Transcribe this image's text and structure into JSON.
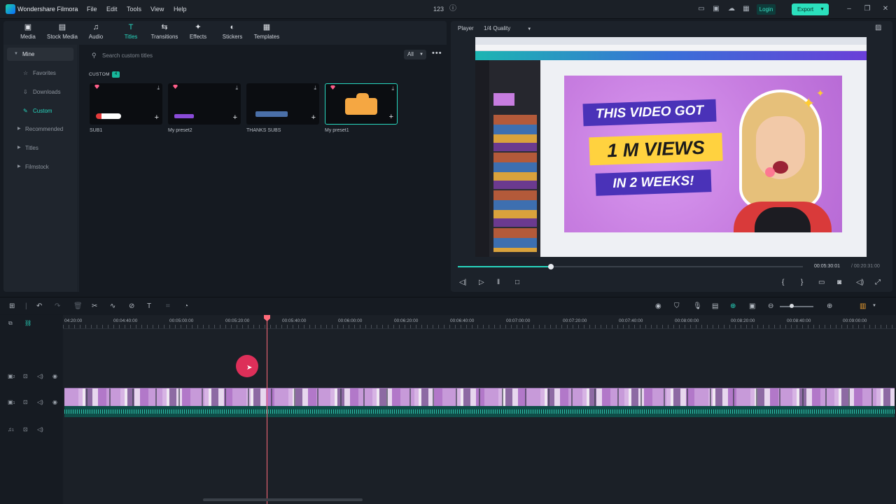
{
  "app": {
    "name": "Wondershare Filmora",
    "menu": [
      "File",
      "Edit",
      "Tools",
      "View",
      "Help"
    ],
    "project_counter": "123",
    "login_label": "Login",
    "export_label": "Export"
  },
  "media_tabs": [
    {
      "label": "Media",
      "icon": "media-icon"
    },
    {
      "label": "Stock Media",
      "icon": "stock-media-icon"
    },
    {
      "label": "Audio",
      "icon": "music-note-icon"
    },
    {
      "label": "Titles",
      "icon": "titles-icon",
      "active": true
    },
    {
      "label": "Transitions",
      "icon": "transitions-icon"
    },
    {
      "label": "Effects",
      "icon": "effects-icon"
    },
    {
      "label": "Stickers",
      "icon": "stickers-icon"
    },
    {
      "label": "Templates",
      "icon": "templates-icon"
    }
  ],
  "sidebar": {
    "items": [
      {
        "label": "Mine"
      },
      {
        "label": "Favorites"
      },
      {
        "label": "Downloads"
      },
      {
        "label": "Custom"
      },
      {
        "label": "Recommended"
      },
      {
        "label": "Titles"
      },
      {
        "label": "Filmstock"
      }
    ]
  },
  "titles_panel": {
    "search_placeholder": "Search custom titles",
    "filter_value": "All",
    "section_label": "CUSTOM",
    "section_count": "4",
    "presets": [
      {
        "name": "SUB1"
      },
      {
        "name": "My preset2"
      },
      {
        "name": "THANKS SUBS"
      },
      {
        "name": "My preset1",
        "selected": true
      }
    ]
  },
  "player": {
    "label": "Player",
    "quality": "1/4 Quality",
    "time_current": "00:05:30:01",
    "time_total": "/ 00:20:31:00",
    "progress": 0.27,
    "preview": {
      "line1": "THIS VIDEO GOT",
      "line2": "1 M VIEWS",
      "line3": "IN 2 WEEKS!"
    }
  },
  "timeline": {
    "ruler_labels": [
      "04:20:00",
      "00:04:40:00",
      "00:05:00:00",
      "00:05:20:00",
      "00:05:40:00",
      "00:06:00:00",
      "00:06:20:00",
      "00:06:40:00",
      "00:07:00:00",
      "00:07:20:00",
      "00:07:40:00",
      "00:08:00:00",
      "00:08:20:00",
      "00:08:40:00",
      "00:09:00:00"
    ],
    "track_numbers": [
      "2",
      "1",
      "1"
    ]
  },
  "colors": {
    "accent": "#28d7bf",
    "playhead": "#ff6b7a",
    "export_button": "#2be0bd"
  }
}
